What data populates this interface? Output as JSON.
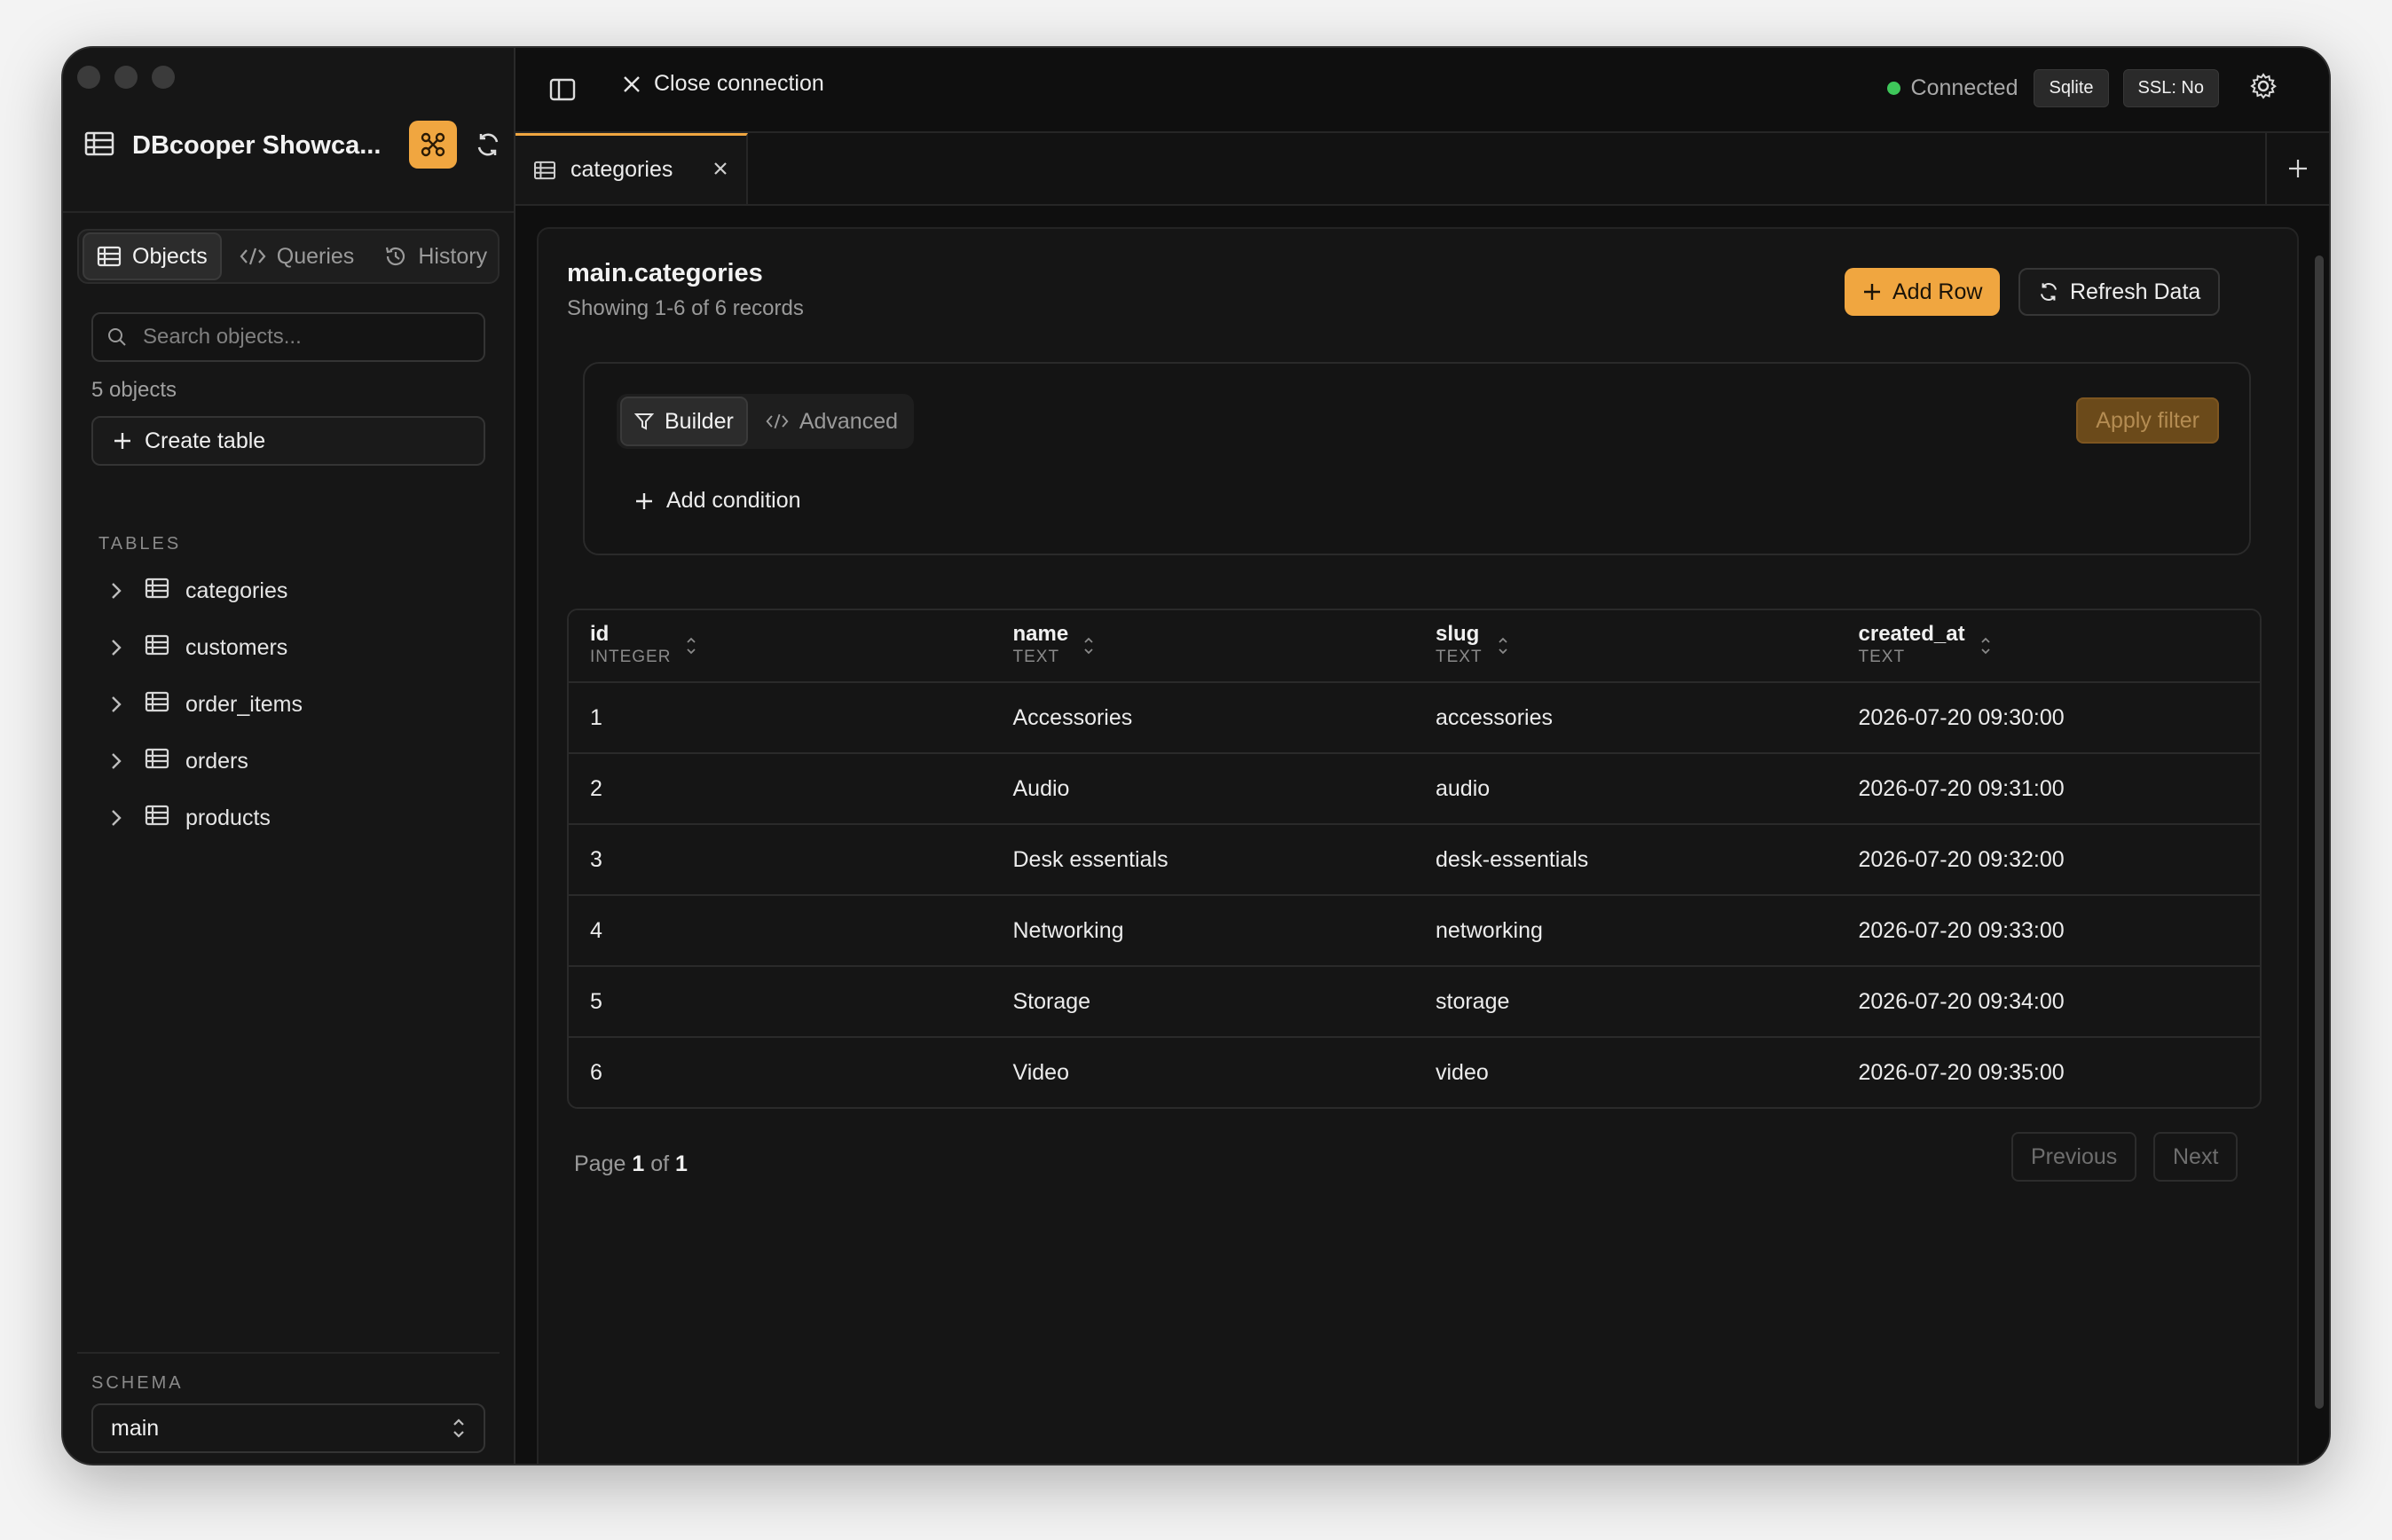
{
  "sidebar": {
    "connection_title": "DBcooper Showca...",
    "tabs": [
      {
        "label": "Objects"
      },
      {
        "label": "Queries"
      },
      {
        "label": "History"
      }
    ],
    "search_placeholder": "Search objects...",
    "object_count": "5 objects",
    "create_table_label": "Create table",
    "tables_label": "TABLES",
    "tables": [
      {
        "name": "categories"
      },
      {
        "name": "customers"
      },
      {
        "name": "order_items"
      },
      {
        "name": "orders"
      },
      {
        "name": "products"
      }
    ],
    "schema_label": "SCHEMA",
    "schema_value": "main"
  },
  "topbar": {
    "close_connection_label": "Close connection",
    "status_text": "Connected",
    "status_color": "#3ec75a",
    "db_chip": "Sqlite",
    "ssl_chip": "SSL: No"
  },
  "tab": {
    "label": "categories"
  },
  "panel": {
    "title": "main.categories",
    "subtitle": "Showing 1-6 of 6 records",
    "add_row_label": "Add Row",
    "refresh_label": "Refresh Data",
    "accent_color": "#f0a640"
  },
  "filter": {
    "builder_label": "Builder",
    "advanced_label": "Advanced",
    "apply_label": "Apply filter",
    "add_condition_label": "Add condition"
  },
  "table": {
    "columns": [
      {
        "name": "id",
        "type": "INTEGER"
      },
      {
        "name": "name",
        "type": "TEXT"
      },
      {
        "name": "slug",
        "type": "TEXT"
      },
      {
        "name": "created_at",
        "type": "TEXT"
      }
    ],
    "rows": [
      [
        "1",
        "Accessories",
        "accessories",
        "2026-07-20 09:30:00"
      ],
      [
        "2",
        "Audio",
        "audio",
        "2026-07-20 09:31:00"
      ],
      [
        "3",
        "Desk essentials",
        "desk-essentials",
        "2026-07-20 09:32:00"
      ],
      [
        "4",
        "Networking",
        "networking",
        "2026-07-20 09:33:00"
      ],
      [
        "5",
        "Storage",
        "storage",
        "2026-07-20 09:34:00"
      ],
      [
        "6",
        "Video",
        "video",
        "2026-07-20 09:35:00"
      ]
    ]
  },
  "pagination": {
    "page_word": "Page",
    "current": "1",
    "of_word": "of",
    "total": "1",
    "previous_label": "Previous",
    "next_label": "Next"
  }
}
